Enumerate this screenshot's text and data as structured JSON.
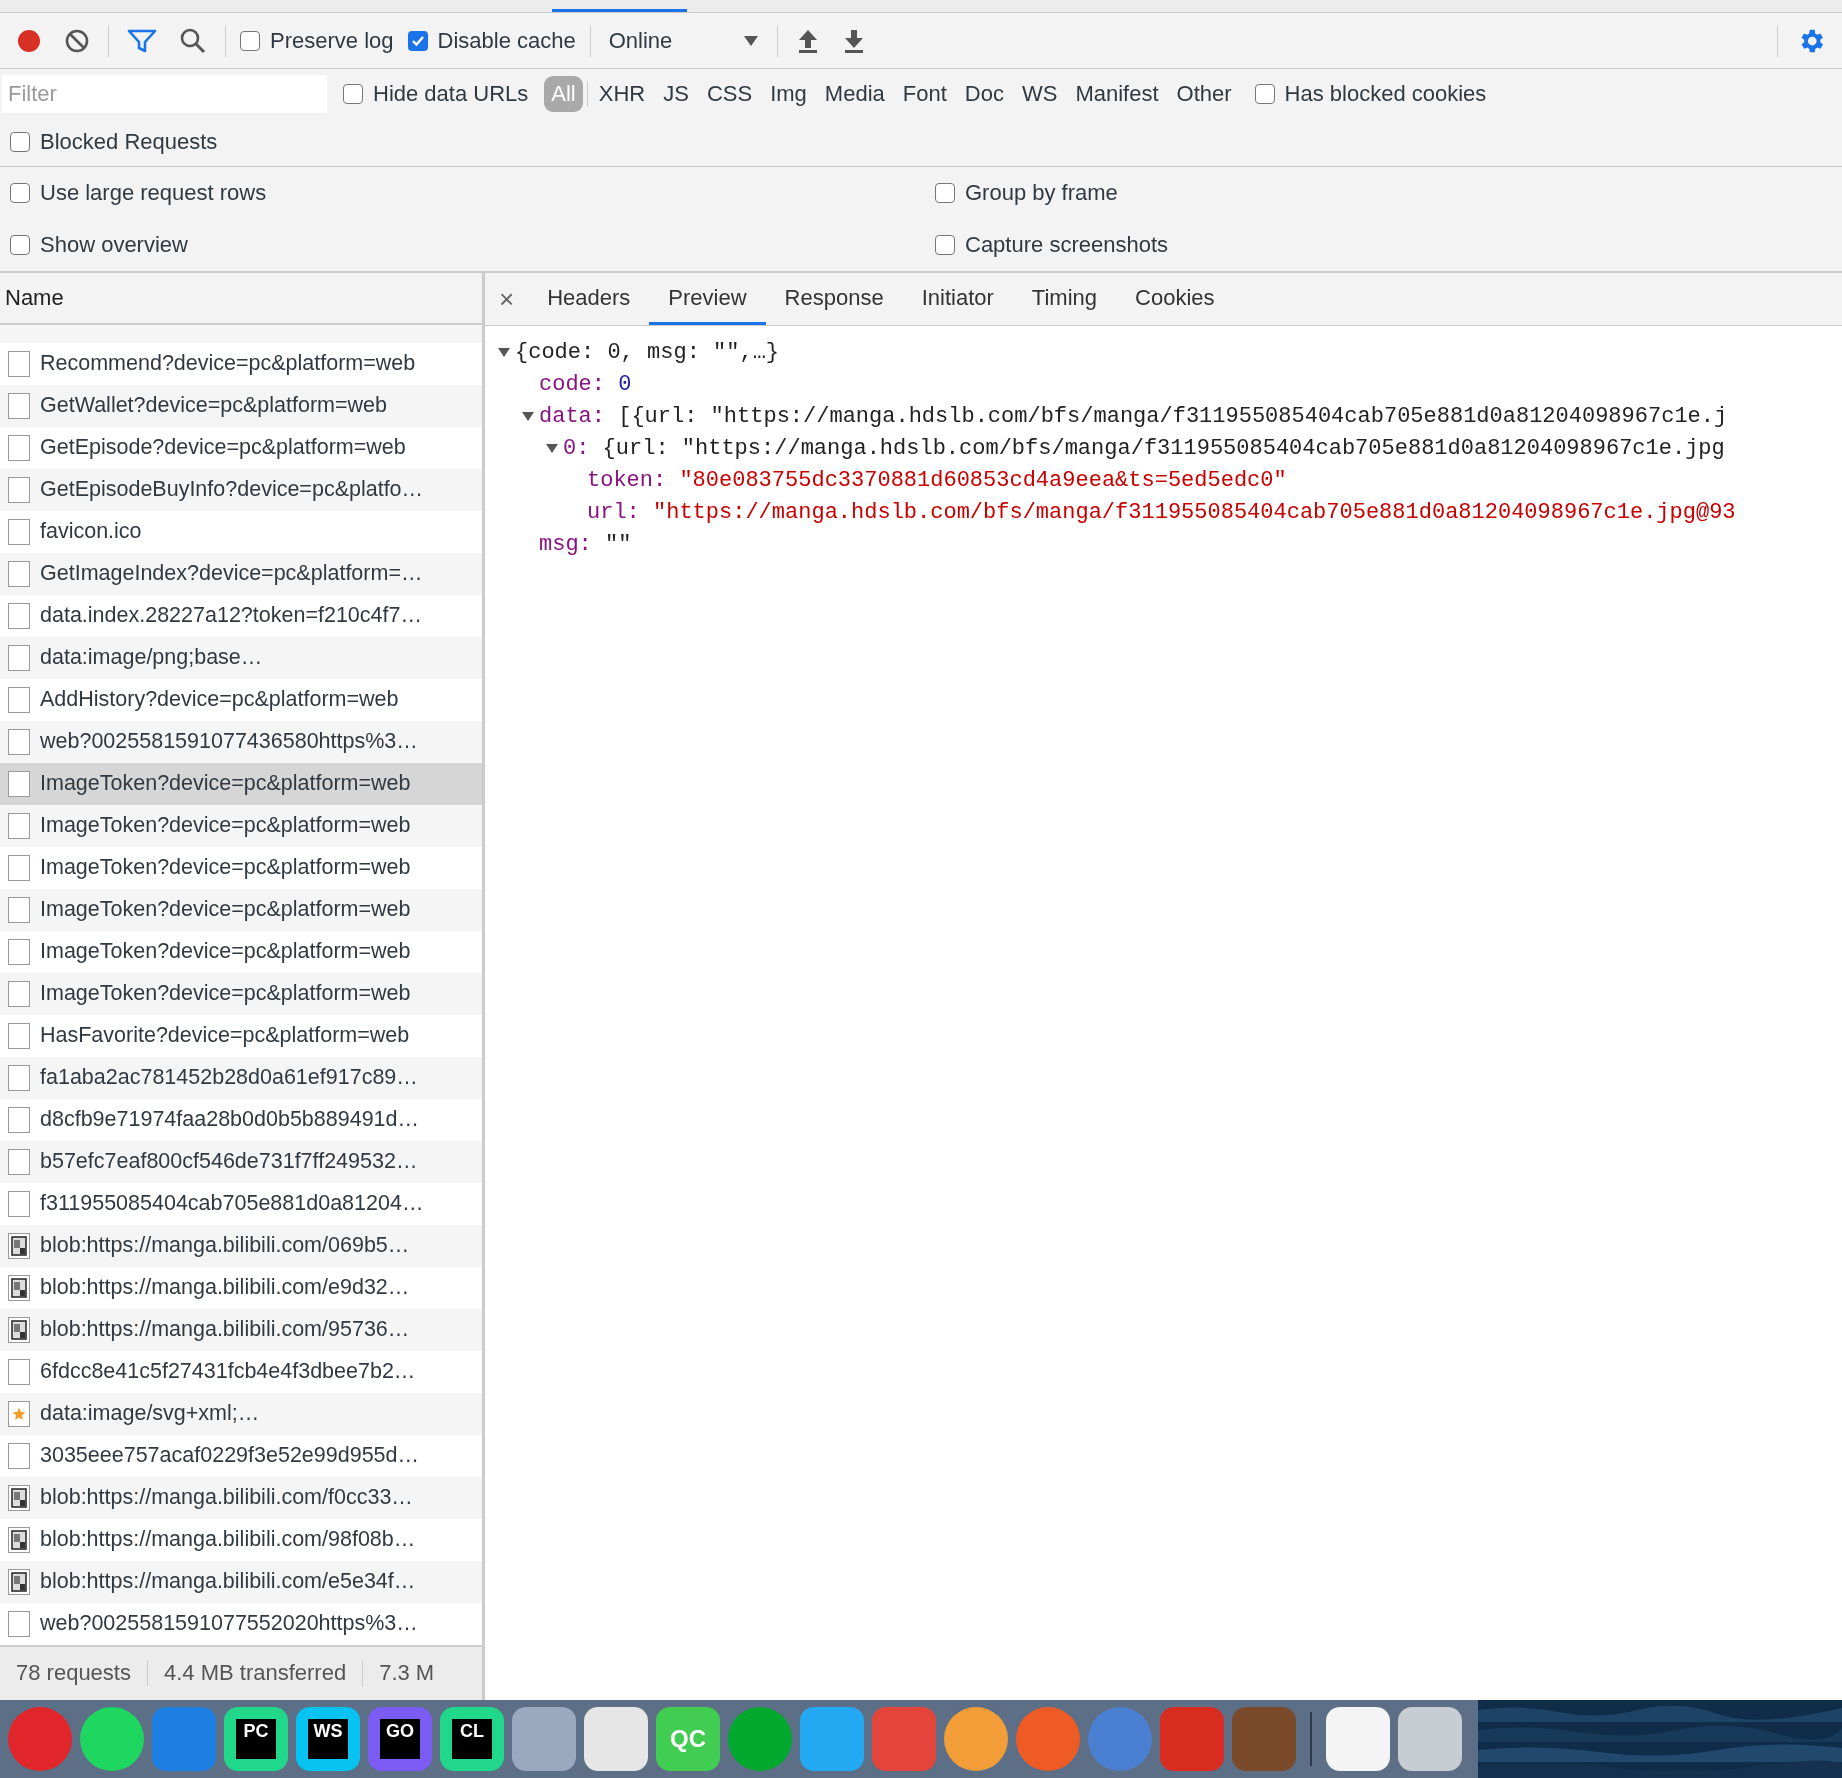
{
  "toolbar": {
    "recording": true,
    "filter_active": true,
    "preserve_log": {
      "label": "Preserve log",
      "checked": false
    },
    "disable_cache": {
      "label": "Disable cache",
      "checked": true
    },
    "throttling": {
      "value": "Online"
    }
  },
  "filter_bar": {
    "placeholder": "Filter",
    "hide_data_urls": {
      "label": "Hide data URLs",
      "checked": false
    },
    "types": [
      {
        "label": "All",
        "selected": true
      },
      {
        "label": "XHR",
        "selected": false
      },
      {
        "label": "JS",
        "selected": false
      },
      {
        "label": "CSS",
        "selected": false
      },
      {
        "label": "Img",
        "selected": false
      },
      {
        "label": "Media",
        "selected": false
      },
      {
        "label": "Font",
        "selected": false
      },
      {
        "label": "Doc",
        "selected": false
      },
      {
        "label": "WS",
        "selected": false
      },
      {
        "label": "Manifest",
        "selected": false
      },
      {
        "label": "Other",
        "selected": false
      }
    ],
    "has_blocked_cookies": {
      "label": "Has blocked cookies",
      "checked": false
    }
  },
  "blocked_requests": {
    "label": "Blocked Requests",
    "checked": false
  },
  "settings": [
    {
      "label": "Use large request rows",
      "checked": false
    },
    {
      "label": "Group by frame",
      "checked": false
    },
    {
      "label": "Show overview",
      "checked": false
    },
    {
      "label": "Capture screenshots",
      "checked": false
    }
  ],
  "requests": {
    "column": "Name",
    "rows": [
      {
        "name": "Recommend?device=pc&platform=web",
        "kind": "blank",
        "selected": false
      },
      {
        "name": "GetWallet?device=pc&platform=web",
        "kind": "blank",
        "selected": false
      },
      {
        "name": "GetEpisode?device=pc&platform=web",
        "kind": "blank",
        "selected": false
      },
      {
        "name": "GetEpisodeBuyInfo?device=pc&platfo…",
        "kind": "blank",
        "selected": false
      },
      {
        "name": "favicon.ico",
        "kind": "blank",
        "selected": false
      },
      {
        "name": "GetImageIndex?device=pc&platform=…",
        "kind": "blank",
        "selected": false
      },
      {
        "name": "data.index.28227a12?token=f210c4f7…",
        "kind": "blank",
        "selected": false
      },
      {
        "name": "data:image/png;base…",
        "kind": "blank",
        "selected": false
      },
      {
        "name": "AddHistory?device=pc&platform=web",
        "kind": "blank",
        "selected": false
      },
      {
        "name": "web?0025581591077436580https%3…",
        "kind": "blank",
        "selected": false
      },
      {
        "name": "ImageToken?device=pc&platform=web",
        "kind": "blank",
        "selected": true
      },
      {
        "name": "ImageToken?device=pc&platform=web",
        "kind": "blank",
        "selected": false
      },
      {
        "name": "ImageToken?device=pc&platform=web",
        "kind": "blank",
        "selected": false
      },
      {
        "name": "ImageToken?device=pc&platform=web",
        "kind": "blank",
        "selected": false
      },
      {
        "name": "ImageToken?device=pc&platform=web",
        "kind": "blank",
        "selected": false
      },
      {
        "name": "ImageToken?device=pc&platform=web",
        "kind": "blank",
        "selected": false
      },
      {
        "name": "HasFavorite?device=pc&platform=web",
        "kind": "blank",
        "selected": false
      },
      {
        "name": "fa1aba2ac781452b28d0a61ef917c89…",
        "kind": "blank",
        "selected": false
      },
      {
        "name": "d8cfb9e71974faa28b0d0b5b889491d…",
        "kind": "blank",
        "selected": false
      },
      {
        "name": "b57efc7eaf800cf546de731f7ff249532…",
        "kind": "blank",
        "selected": false
      },
      {
        "name": "f311955085404cab705e881d0a81204…",
        "kind": "blank",
        "selected": false
      },
      {
        "name": "blob:https://manga.bilibili.com/069b5…",
        "kind": "thumbnail",
        "selected": false
      },
      {
        "name": "blob:https://manga.bilibili.com/e9d32…",
        "kind": "thumbnail",
        "selected": false
      },
      {
        "name": "blob:https://manga.bilibili.com/95736…",
        "kind": "thumbnail",
        "selected": false
      },
      {
        "name": "6fdcc8e41c5f27431fcb4e4f3dbee7b2…",
        "kind": "blank",
        "selected": false
      },
      {
        "name": "data:image/svg+xml;…",
        "kind": "star",
        "selected": false
      },
      {
        "name": "3035eee757acaf0229f3e52e99d955d…",
        "kind": "blank",
        "selected": false
      },
      {
        "name": "blob:https://manga.bilibili.com/f0cc33…",
        "kind": "thumbnail",
        "selected": false
      },
      {
        "name": "blob:https://manga.bilibili.com/98f08b…",
        "kind": "thumbnail",
        "selected": false
      },
      {
        "name": "blob:https://manga.bilibili.com/e5e34f…",
        "kind": "thumbnail",
        "selected": false
      },
      {
        "name": "web?0025581591077552020https%3…",
        "kind": "blank",
        "selected": false
      }
    ]
  },
  "summary": [
    "78 requests",
    "4.4 MB transferred",
    "7.3 M"
  ],
  "detail": {
    "close": "×",
    "tabs": [
      {
        "label": "Headers",
        "selected": false
      },
      {
        "label": "Preview",
        "selected": true
      },
      {
        "label": "Response",
        "selected": false
      },
      {
        "label": "Initiator",
        "selected": false
      },
      {
        "label": "Timing",
        "selected": false
      },
      {
        "label": "Cookies",
        "selected": false
      }
    ],
    "preview": {
      "summary": "{code: 0, msg: \"\",…}",
      "expanded": true,
      "children": [
        {
          "key": "code:",
          "value": "0",
          "kind": "number"
        },
        {
          "key": "data:",
          "summary": "[{url: \"https://manga.hdslb.com/bfs/manga/f311955085404cab705e881d0a81204098967c1e.j",
          "expanded": true,
          "children": [
            {
              "key": "0:",
              "summary": "{url: \"https://manga.hdslb.com/bfs/manga/f311955085404cab705e881d0a81204098967c1e.jpg",
              "expanded": true,
              "children": [
                {
                  "key": "token:",
                  "value": "\"80e083755dc3370881d60853cd4a9eea&ts=5ed5edc0\"",
                  "kind": "string"
                },
                {
                  "key": "url:",
                  "value": "\"https://manga.hdslb.com/bfs/manga/f311955085404cab705e881d0a81204098967c1e.jpg@93",
                  "kind": "string"
                }
              ]
            }
          ]
        },
        {
          "key": "msg:",
          "value": "\"\"",
          "kind": "plain"
        }
      ]
    }
  },
  "dock": [
    {
      "kind": "round",
      "color": "#e0262b"
    },
    {
      "kind": "round",
      "color": "#1ed760"
    },
    {
      "kind": "tile",
      "color": "#1c7ee0"
    },
    {
      "kind": "badge",
      "color": "#21d789",
      "label": "PC"
    },
    {
      "kind": "badge",
      "color": "#07c3f2",
      "label": "WS"
    },
    {
      "kind": "badge",
      "color": "#7b5cf5",
      "label": "GO"
    },
    {
      "kind": "badge",
      "color": "#21d789",
      "label": "CL"
    },
    {
      "kind": "tile",
      "color": "#9aa8c0"
    },
    {
      "kind": "tile",
      "color": "#e6e6e6"
    },
    {
      "kind": "tile",
      "color": "#41cd52",
      "label": "QC"
    },
    {
      "kind": "round",
      "color": "#00a82d"
    },
    {
      "kind": "tile",
      "color": "#23a9f2"
    },
    {
      "kind": "tile",
      "color": "#e4453a"
    },
    {
      "kind": "round",
      "color": "#f29d38"
    },
    {
      "kind": "round",
      "color": "#ef5b25"
    },
    {
      "kind": "round",
      "color": "#4a7fd1"
    },
    {
      "kind": "tile",
      "color": "#d82c20"
    },
    {
      "kind": "tile",
      "color": "#7a4a2a"
    },
    {
      "kind": "separator"
    },
    {
      "kind": "tile",
      "color": "#f4f4f4"
    },
    {
      "kind": "tile",
      "color": "#c8cdd3"
    }
  ]
}
